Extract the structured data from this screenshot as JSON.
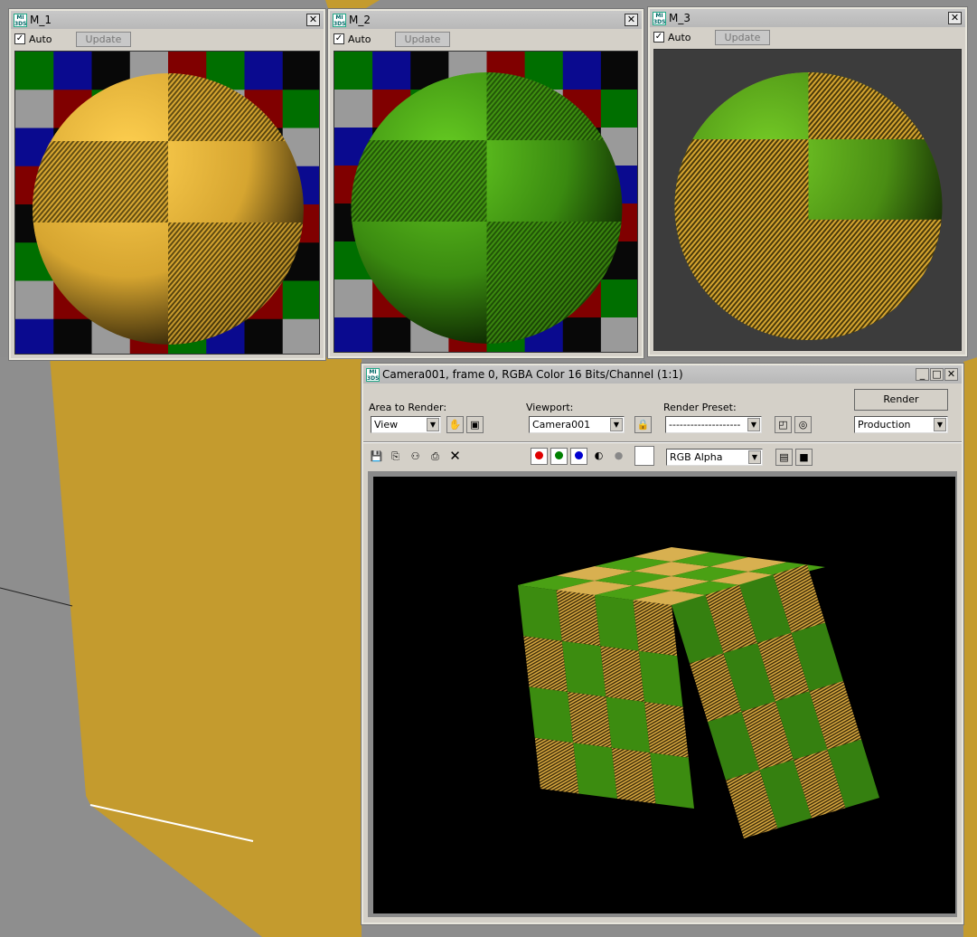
{
  "material_windows": [
    {
      "title": "M_1",
      "auto_label": "Auto",
      "auto_checked": true,
      "update_label": "Update"
    },
    {
      "title": "M_2",
      "auto_label": "Auto",
      "auto_checked": true,
      "update_label": "Update"
    },
    {
      "title": "M_3",
      "auto_label": "Auto",
      "auto_checked": true,
      "update_label": "Update"
    }
  ],
  "render_window": {
    "title": "Camera001, frame 0, RGBA Color 16 Bits/Channel (1:1)",
    "area_label": "Area to Render:",
    "area_value": "View",
    "viewport_label": "Viewport:",
    "viewport_value": "Camera001",
    "preset_label": "Render Preset:",
    "preset_value": "--------------------",
    "render_label": "Render",
    "mode_value": "Production",
    "channel_value": "RGB Alpha",
    "colors": {
      "red": "#e00000",
      "green": "#008000",
      "blue": "#0000d0"
    }
  }
}
